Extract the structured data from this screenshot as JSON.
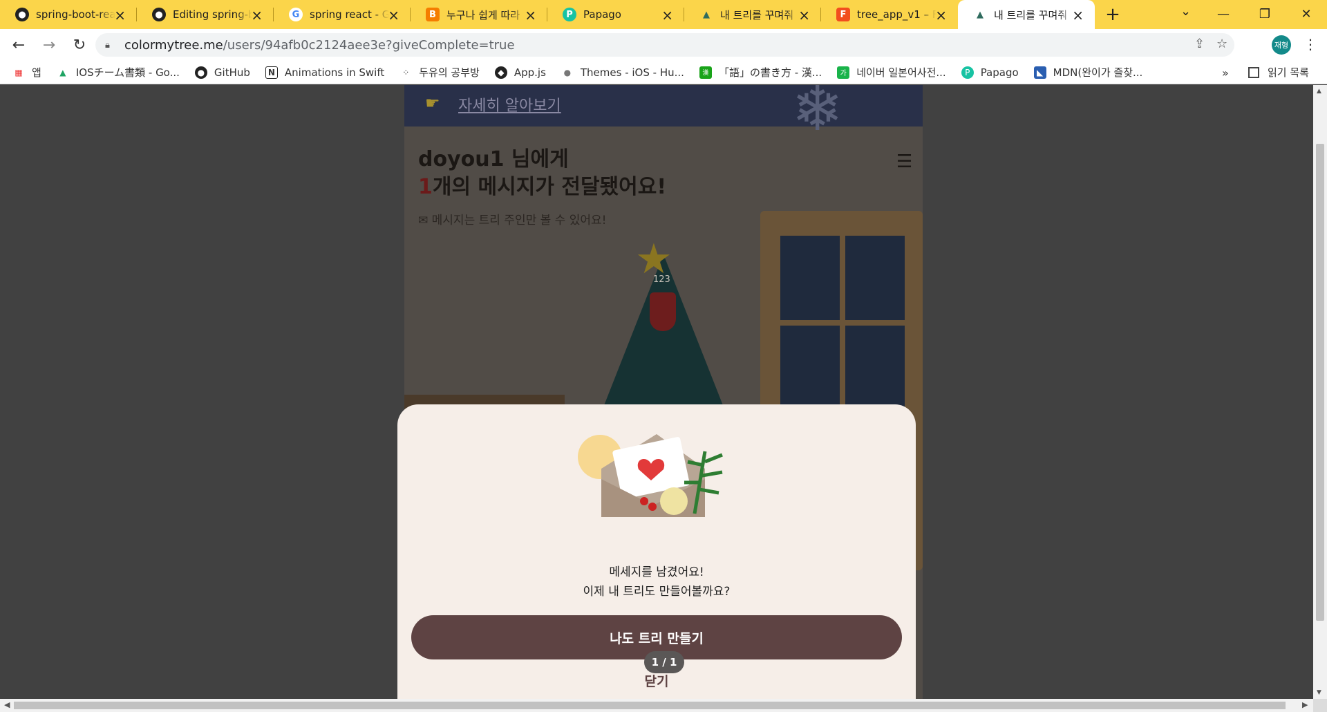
{
  "tabs": [
    {
      "title": "spring-boot-react",
      "icon": "github-icon",
      "active": false
    },
    {
      "title": "Editing spring-bo",
      "icon": "github-icon",
      "active": false
    },
    {
      "title": "spring react - Go",
      "icon": "google-icon",
      "active": false
    },
    {
      "title": "누구나 쉽게 따라",
      "icon": "blogger-icon",
      "active": false
    },
    {
      "title": "Papago",
      "icon": "papago-icon",
      "active": false
    },
    {
      "title": "내 트리를 꾸며줘",
      "icon": "tree-icon",
      "active": false
    },
    {
      "title": "tree_app_v1 – Fig",
      "icon": "figma-icon",
      "active": false
    },
    {
      "title": "내 트리를 꾸며줘",
      "icon": "tree-icon",
      "active": true
    }
  ],
  "address": {
    "host": "colormytree.me",
    "path": "/users/94afb0c2124aee3e?giveComplete=true"
  },
  "profile": {
    "initials": "재형"
  },
  "bookmarks": [
    {
      "label": "앱",
      "icon": "apps-grid-icon"
    },
    {
      "label": "IOSチーム書類 - Go...",
      "icon": "google-drive-icon"
    },
    {
      "label": "GitHub",
      "icon": "github-icon"
    },
    {
      "label": "Animations in Swift",
      "icon": "notion-icon"
    },
    {
      "label": "두유의 공부방",
      "icon": "dots-icon"
    },
    {
      "label": "App.js",
      "icon": "appjs-icon"
    },
    {
      "label": "Themes - iOS - Hu...",
      "icon": "apple-icon"
    },
    {
      "label": "「語」の書き方 - 漢...",
      "icon": "kanji-icon"
    },
    {
      "label": "네이버 일본어사전...",
      "icon": "naver-icon"
    },
    {
      "label": "Papago",
      "icon": "papago-icon"
    },
    {
      "label": "MDN(완이가 즐찾...",
      "icon": "mdn-icon"
    }
  ],
  "reading_list": "읽기 목록",
  "page": {
    "banner_link": "자세히 알아보기",
    "heading_line1": "doyou1 님에게",
    "heading_count": "1",
    "heading_line2_rest": "개의 메시지가 전달됐어요!",
    "subnote": "메시지는 트리 주인만 볼 수 있어요!",
    "tree_count": "123"
  },
  "modal": {
    "line1": "메세지를 남겼어요!",
    "line2": "이제 내 트리도 만들어볼까요?",
    "create_button": "나도 트리 만들기",
    "close_link": "닫기",
    "pager": "1 / 1"
  },
  "colors": {
    "tab_bar": "#fbd54a",
    "modal_bg": "#f6eee8",
    "button": "#5e4343"
  }
}
